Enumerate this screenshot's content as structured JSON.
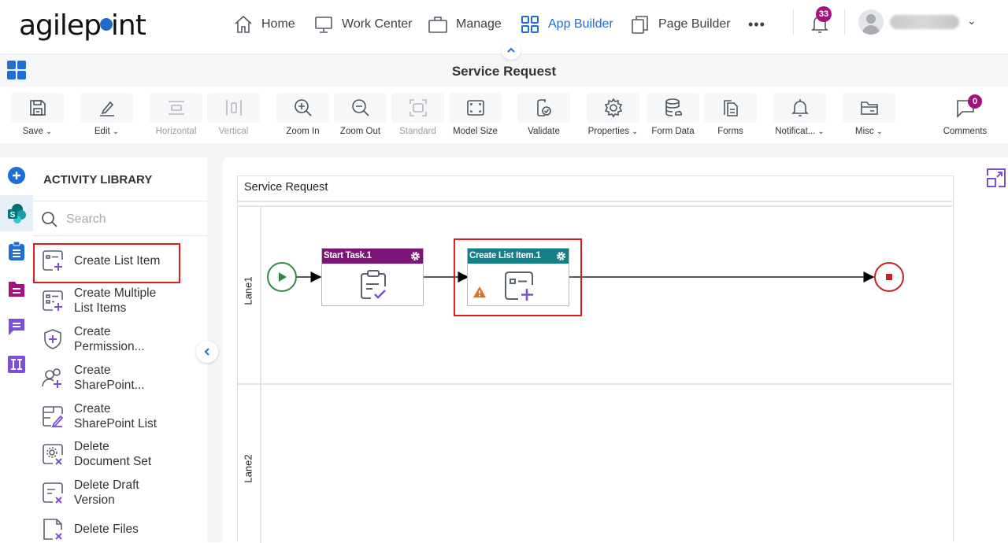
{
  "brand": {
    "logo_text_a": "agilep",
    "logo_text_b": "int"
  },
  "topnav": {
    "items": [
      {
        "label": "Home",
        "icon": "home-icon",
        "active": false
      },
      {
        "label": "Work Center",
        "icon": "monitor-icon",
        "active": false
      },
      {
        "label": "Manage",
        "icon": "briefcase-icon",
        "active": false
      },
      {
        "label": "App Builder",
        "icon": "app-grid-icon",
        "active": true
      },
      {
        "label": "Page Builder",
        "icon": "pages-icon",
        "active": false
      }
    ],
    "more_label": "•••",
    "notifications_count": "33",
    "user_chevron": "⌄"
  },
  "titlebar": {
    "title": "Service Request"
  },
  "toolbar": {
    "buttons": [
      {
        "label": "Save",
        "dropdown": true,
        "disabled": false,
        "icon": "save-icon"
      },
      {
        "label": "Edit",
        "dropdown": true,
        "disabled": false,
        "icon": "edit-icon"
      },
      {
        "label": "Horizontal",
        "dropdown": false,
        "disabled": true,
        "icon": "horizontal-icon"
      },
      {
        "label": "Vertical",
        "dropdown": false,
        "disabled": true,
        "icon": "vertical-icon"
      },
      {
        "label": "Zoom In",
        "dropdown": false,
        "disabled": false,
        "icon": "zoom-in-icon"
      },
      {
        "label": "Zoom Out",
        "dropdown": false,
        "disabled": false,
        "icon": "zoom-out-icon"
      },
      {
        "label": "Standard",
        "dropdown": false,
        "disabled": true,
        "icon": "standard-icon"
      },
      {
        "label": "Model Size",
        "dropdown": false,
        "disabled": false,
        "icon": "model-size-icon"
      },
      {
        "label": "Validate",
        "dropdown": false,
        "disabled": false,
        "icon": "validate-icon"
      },
      {
        "label": "Properties",
        "dropdown": true,
        "disabled": false,
        "icon": "gear-icon"
      },
      {
        "label": "Form Data",
        "dropdown": false,
        "disabled": false,
        "icon": "database-icon"
      },
      {
        "label": "Forms",
        "dropdown": false,
        "disabled": false,
        "icon": "forms-icon"
      },
      {
        "label": "Notificat...",
        "dropdown": true,
        "disabled": false,
        "icon": "bell-icon"
      },
      {
        "label": "Misc",
        "dropdown": true,
        "disabled": false,
        "icon": "folder-icon"
      }
    ],
    "comments": {
      "label": "Comments",
      "count": "0"
    },
    "chevron": "⌄"
  },
  "rail": {
    "items": [
      {
        "name": "add-activity",
        "active": false
      },
      {
        "name": "sharepoint",
        "active": true
      },
      {
        "name": "task-clipboard",
        "active": false
      },
      {
        "name": "form-folder",
        "active": false
      },
      {
        "name": "chat",
        "active": false
      },
      {
        "name": "integration",
        "active": false
      }
    ]
  },
  "library": {
    "title": "ACTIVITY LIBRARY",
    "search_placeholder": "Search",
    "search_value": "",
    "items": [
      {
        "line1": "Create List Item",
        "line2": "",
        "highlighted": true
      },
      {
        "line1": "Create Multiple",
        "line2": "List Items",
        "highlighted": false
      },
      {
        "line1": "Create",
        "line2": "Permission...",
        "highlighted": false
      },
      {
        "line1": "Create",
        "line2": "SharePoint...",
        "highlighted": false
      },
      {
        "line1": "Create",
        "line2": "SharePoint List",
        "highlighted": false
      },
      {
        "line1": "Delete",
        "line2": "Document Set",
        "highlighted": false
      },
      {
        "line1": "Delete Draft",
        "line2": "Version",
        "highlighted": false
      },
      {
        "line1": "Delete Files",
        "line2": "",
        "highlighted": false
      }
    ]
  },
  "diagram": {
    "pool_title": "Service Request",
    "lanes": [
      "Lane1",
      "Lane2"
    ],
    "nodes": [
      {
        "id": "start-task-1",
        "title": "Start Task.1",
        "header_color": "#7b1577",
        "warning": false
      },
      {
        "id": "create-list-item-1",
        "title": "Create List Item.1",
        "header_color": "#147f87",
        "warning": true,
        "selected": true
      }
    ],
    "colors": {
      "start_event": "#2e8b47",
      "end_event": "#c42026",
      "warning": "#e0701e",
      "selection": "#e01b1b"
    }
  },
  "colors": {
    "accent": "#1d6fd3",
    "badge": "#a3127f",
    "icon_purple": "#7b4fd6"
  }
}
